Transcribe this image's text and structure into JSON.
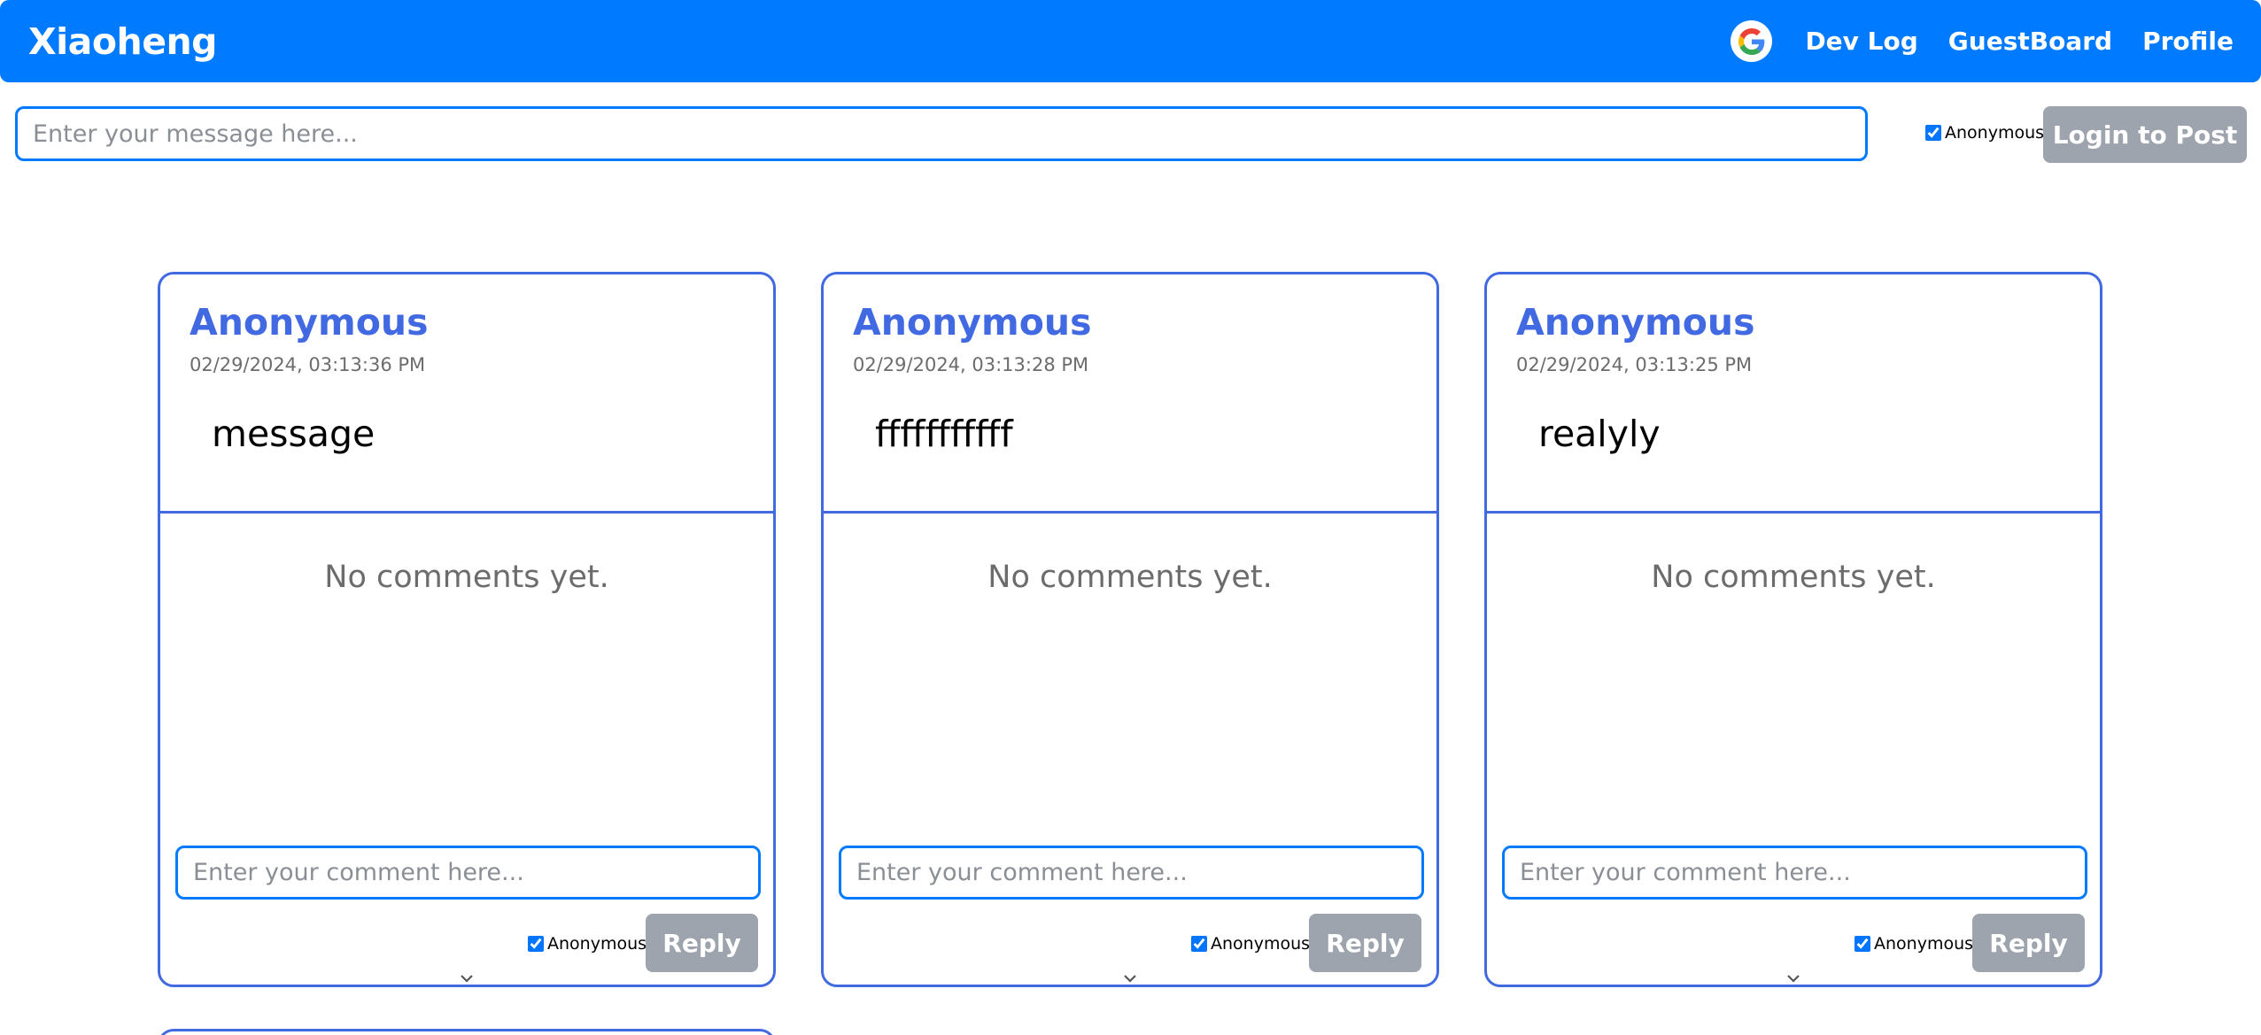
{
  "header": {
    "brand": "Xiaoheng",
    "nav": [
      "Dev Log",
      "GuestBoard",
      "Profile"
    ],
    "google_icon": "google-icon"
  },
  "post_form": {
    "placeholder": "Enter your message here...",
    "anonymous_label": "Anonymous",
    "anonymous_checked": true,
    "login_button": "Login to Post"
  },
  "colors": {
    "primary": "#007bff",
    "card_border": "#4169e1",
    "disabled_button": "#9ea4ad"
  },
  "cards": [
    {
      "author": "Anonymous",
      "timestamp": "02/29/2024, 03:13:36 PM",
      "message": "message",
      "no_comments": "No comments yet.",
      "comment_placeholder": "Enter your comment here...",
      "anonymous_label": "Anonymous",
      "reply": "Reply"
    },
    {
      "author": "Anonymous",
      "timestamp": "02/29/2024, 03:13:28 PM",
      "message": "fffffffffff",
      "no_comments": "No comments yet.",
      "comment_placeholder": "Enter your comment here...",
      "anonymous_label": "Anonymous",
      "reply": "Reply"
    },
    {
      "author": "Anonymous",
      "timestamp": "02/29/2024, 03:13:25 PM",
      "message": "realyly",
      "no_comments": "No comments yet.",
      "comment_placeholder": "Enter your comment here...",
      "anonymous_label": "Anonymous",
      "reply": "Reply"
    }
  ]
}
